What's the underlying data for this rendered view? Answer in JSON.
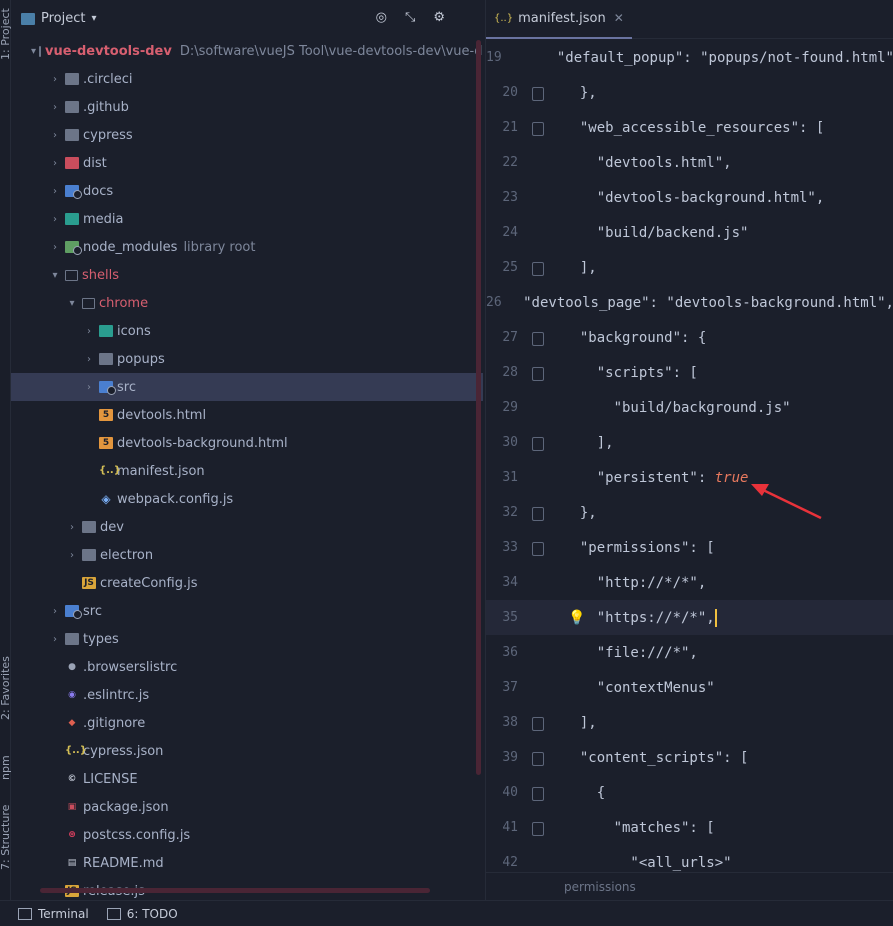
{
  "side_tabs": {
    "project": "1: Project",
    "favorites": "2: Favorites",
    "npm": "npm",
    "structure": "7: Structure"
  },
  "project_panel": {
    "title": "Project",
    "tree": [
      {
        "label": "vue-devtools-dev",
        "extra": "D:\\software\\vueJS Tool\\vue-devtools-dev\\vue-devtools",
        "depth": 0,
        "arrow": "▾",
        "icon": "folder-open"
      },
      {
        "label": ".circleci",
        "depth": 1,
        "arrow": "›",
        "icon": "folder"
      },
      {
        "label": ".github",
        "depth": 1,
        "arrow": "›",
        "icon": "folder"
      },
      {
        "label": "cypress",
        "depth": 1,
        "arrow": "›",
        "icon": "folder"
      },
      {
        "label": "dist",
        "depth": 1,
        "arrow": "›",
        "icon": "folder-red"
      },
      {
        "label": "docs",
        "depth": 1,
        "arrow": "›",
        "icon": "folder-blue"
      },
      {
        "label": "media",
        "depth": 1,
        "arrow": "›",
        "icon": "folder-teal"
      },
      {
        "label": "node_modules",
        "extra": "library root",
        "depth": 1,
        "arrow": "›",
        "icon": "folder-green"
      },
      {
        "label": "shells",
        "depth": 1,
        "arrow": "▾",
        "icon": "folder-open"
      },
      {
        "label": "chrome",
        "depth": 2,
        "arrow": "▾",
        "icon": "folder-open"
      },
      {
        "label": "icons",
        "depth": 3,
        "arrow": "›",
        "icon": "folder-teal"
      },
      {
        "label": "popups",
        "depth": 3,
        "arrow": "›",
        "icon": "folder"
      },
      {
        "label": "src",
        "depth": 3,
        "arrow": "›",
        "icon": "folder-blue"
      },
      {
        "label": "devtools.html",
        "depth": 3,
        "arrow": "",
        "icon": "html"
      },
      {
        "label": "devtools-background.html",
        "depth": 3,
        "arrow": "",
        "icon": "html"
      },
      {
        "label": "manifest.json",
        "depth": 3,
        "arrow": "",
        "icon": "json"
      },
      {
        "label": "webpack.config.js",
        "depth": 3,
        "arrow": "",
        "icon": "webpack"
      },
      {
        "label": "dev",
        "depth": 2,
        "arrow": "›",
        "icon": "folder"
      },
      {
        "label": "electron",
        "depth": 2,
        "arrow": "›",
        "icon": "folder"
      },
      {
        "label": "createConfig.js",
        "depth": 2,
        "arrow": "",
        "icon": "js"
      },
      {
        "label": "src",
        "depth": 1,
        "arrow": "›",
        "icon": "folder-blue"
      },
      {
        "label": "types",
        "depth": 1,
        "arrow": "›",
        "icon": "folder"
      },
      {
        "label": ".browserslistrc",
        "depth": 1,
        "arrow": "",
        "icon": "dot"
      },
      {
        "label": ".eslintrc.js",
        "depth": 1,
        "arrow": "",
        "icon": "eslint"
      },
      {
        "label": ".gitignore",
        "depth": 1,
        "arrow": "",
        "icon": "git"
      },
      {
        "label": "cypress.json",
        "depth": 1,
        "arrow": "",
        "icon": "json"
      },
      {
        "label": "LICENSE",
        "depth": 1,
        "arrow": "",
        "icon": "license"
      },
      {
        "label": "package.json",
        "depth": 1,
        "arrow": "",
        "icon": "package"
      },
      {
        "label": "postcss.config.js",
        "depth": 1,
        "arrow": "",
        "icon": "postcss"
      },
      {
        "label": "README.md",
        "depth": 1,
        "arrow": "",
        "icon": "md"
      },
      {
        "label": "release.js",
        "depth": 1,
        "arrow": "",
        "icon": "js"
      }
    ]
  },
  "editor": {
    "tab_label": "manifest.json",
    "tab_icon": "{..}",
    "breadcrumb": "permissions",
    "lines": [
      {
        "n": "19",
        "text": "    \"default_popup\": \"popups/not-found.html\""
      },
      {
        "n": "20",
        "text": "  },"
      },
      {
        "n": "21",
        "text": "  \"web_accessible_resources\": ["
      },
      {
        "n": "22",
        "text": "    \"devtools.html\","
      },
      {
        "n": "23",
        "text": "    \"devtools-background.html\","
      },
      {
        "n": "24",
        "text": "    \"build/backend.js\""
      },
      {
        "n": "25",
        "text": "  ],"
      },
      {
        "n": "26",
        "text": "  \"devtools_page\": \"devtools-background.html\","
      },
      {
        "n": "27",
        "text": "  \"background\": {"
      },
      {
        "n": "28",
        "text": "    \"scripts\": ["
      },
      {
        "n": "29",
        "text": "      \"build/background.js\""
      },
      {
        "n": "30",
        "text": "    ],"
      },
      {
        "n": "31",
        "text": "    \"persistent\": ",
        "bool": "true"
      },
      {
        "n": "32",
        "text": "  },"
      },
      {
        "n": "33",
        "text": "  \"permissions\": ["
      },
      {
        "n": "34",
        "text": "    \"http://*/*\","
      },
      {
        "n": "35",
        "text": "    \"https://*/*\",",
        "current": true
      },
      {
        "n": "36",
        "text": "    \"file:///*\","
      },
      {
        "n": "37",
        "text": "    \"contextMenus\""
      },
      {
        "n": "38",
        "text": "  ],"
      },
      {
        "n": "39",
        "text": "  \"content_scripts\": ["
      },
      {
        "n": "40",
        "text": "    {"
      },
      {
        "n": "41",
        "text": "      \"matches\": ["
      },
      {
        "n": "42",
        "text": "        \"<all_urls>\""
      }
    ],
    "fold_lines": [
      "20",
      "21",
      "25",
      "27",
      "28",
      "30",
      "32",
      "33",
      "38",
      "39",
      "40",
      "41"
    ]
  },
  "statusbar": {
    "terminal": "Terminal",
    "todo": "6: TODO"
  },
  "colors": {
    "selection": "#353b54",
    "accent_red": "#d75f70",
    "bool": "#e8795e",
    "annotation_arrow": "#e8323a"
  }
}
